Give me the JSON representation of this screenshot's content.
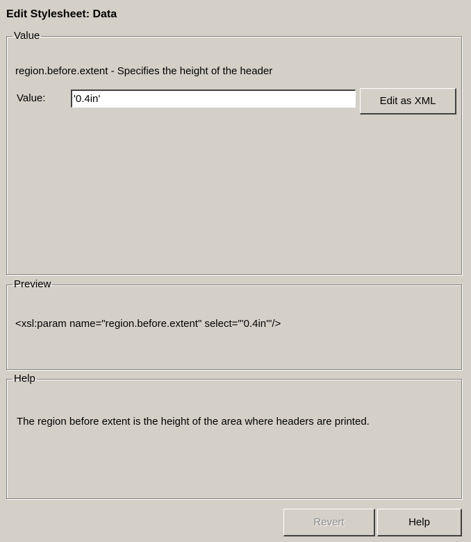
{
  "dialog": {
    "title": "Edit Stylesheet: Data"
  },
  "value_group": {
    "legend": "Value",
    "description": "region.before.extent - Specifies the height of the header",
    "value_label": "Value:",
    "value": "'0.4in'",
    "edit_xml_label": "Edit as XML"
  },
  "preview_group": {
    "legend": "Preview",
    "text": "<xsl:param name=\"region.before.extent\" select=\"'0.4in'\"/>"
  },
  "help_group": {
    "legend": "Help",
    "text": "The region before extent is the height of the area where headers are printed."
  },
  "buttons": {
    "revert_label": "Revert",
    "revert_enabled": false,
    "help_label": "Help"
  }
}
